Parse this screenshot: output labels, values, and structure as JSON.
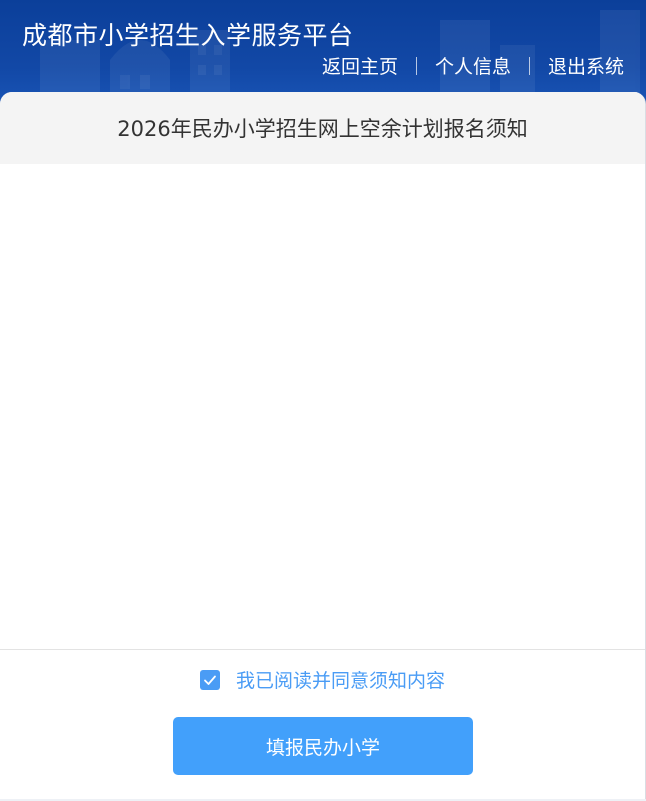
{
  "header": {
    "title": "成都市小学招生入学服务平台",
    "nav": {
      "home": "返回主页",
      "profile": "个人信息",
      "logout": "退出系统"
    }
  },
  "notice": {
    "title": "2026年民办小学招生网上空余计划报名须知"
  },
  "footer": {
    "agree_label": "我已阅读并同意须知内容",
    "agree_checked": true,
    "submit_label": "填报民办小学"
  },
  "colors": {
    "header_bg": "#0b3f9a",
    "accent": "#42a0fb",
    "checkbox": "#4a9cf5"
  }
}
